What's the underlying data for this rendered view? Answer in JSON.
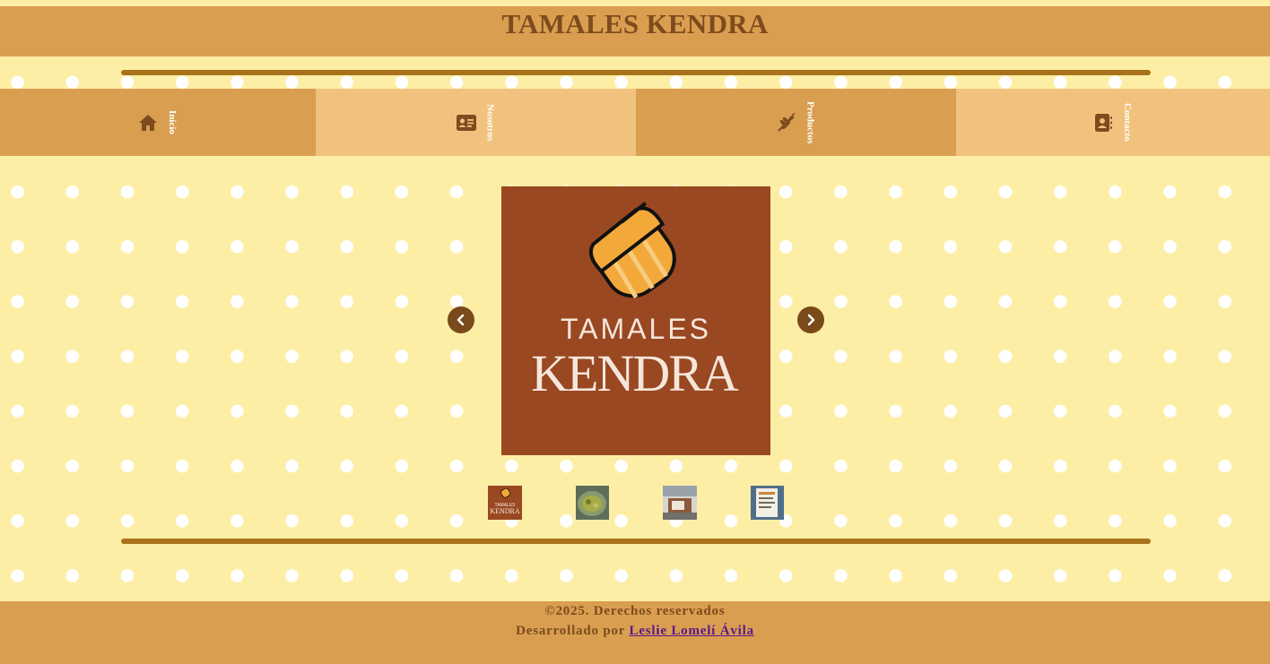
{
  "header": {
    "title": "TAMALES KENDRA"
  },
  "nav": {
    "items": [
      {
        "label": "Inicio",
        "icon": "home-icon"
      },
      {
        "label": "Nosotros",
        "icon": "id-card-icon"
      },
      {
        "label": "Productos",
        "icon": "wheat-icon"
      },
      {
        "label": "Contacto",
        "icon": "contact-book-icon"
      }
    ]
  },
  "carousel": {
    "logo_line1": "TAMALES",
    "logo_line2": "KENDRA",
    "prev_icon": "chevron-left-icon",
    "next_icon": "chevron-right-icon",
    "thumb_logo_line1": "TAMALES",
    "thumb_logo_line2": "KENDRA"
  },
  "footer": {
    "copyright": "©2025. Derechos reservados",
    "developed_by": "Desarrollado por",
    "author": "Leslie Lomelí Ávila"
  },
  "colors": {
    "background": "#fdeea6",
    "header": "#d99e50",
    "nav_light": "#f0c27e",
    "accent_dark": "#7d4b1d",
    "rule": "#a8721b",
    "logo_bg": "#994822",
    "link": "#5b178a"
  }
}
